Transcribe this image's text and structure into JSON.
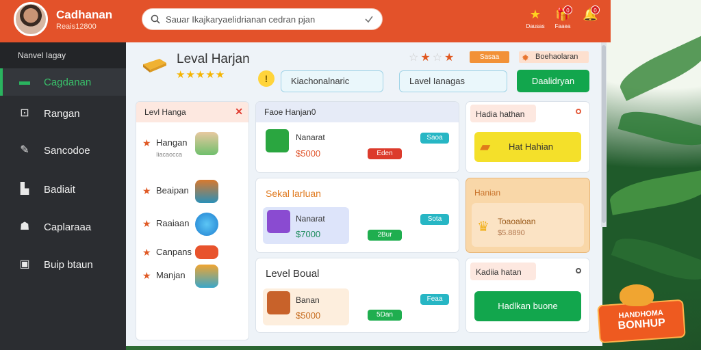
{
  "header": {
    "user_name": "Cadhanan",
    "user_sub": "Reais12800",
    "search_placeholder": "Sauar Ikajkaryaelidrianan cedran pjan",
    "icons": [
      {
        "name": "star-icon",
        "label": "Dausas",
        "glyph": "★",
        "color": "#ffd21f",
        "badge": ""
      },
      {
        "name": "gift-icon",
        "label": "Faaea",
        "glyph": "🎁",
        "color": "#ffffff",
        "badge": "0"
      },
      {
        "name": "bell-icon",
        "label": "",
        "glyph": "🔔",
        "color": "#ffffff",
        "badge": "0"
      }
    ]
  },
  "sidebar": {
    "heading": "Nanvel Iagay",
    "items": [
      {
        "label": "Cagdanan",
        "icon": "chat-icon",
        "glyph": "▬",
        "active": true
      },
      {
        "label": "Rangan",
        "icon": "grid-icon",
        "glyph": "⊡",
        "active": false
      },
      {
        "label": "Sancodoe",
        "icon": "tag-icon",
        "glyph": "✎",
        "active": false
      },
      {
        "label": "Badiait",
        "icon": "boot-icon",
        "glyph": "▙",
        "active": false
      },
      {
        "label": "Caplaraaa",
        "icon": "hat-icon",
        "glyph": "☗",
        "active": false
      },
      {
        "label": "Buip btaun",
        "icon": "box-icon",
        "glyph": "▣",
        "active": false
      }
    ]
  },
  "level": {
    "title": "Leval Harjan",
    "stars": "★★★★★",
    "rating_stars": "☆★☆★",
    "chip_orange": "Sasaa",
    "chip_peach": "Boehaolaran",
    "field1": "Kiachonalnaric",
    "field2": "Lavel Ianagas",
    "button": "Daalidryan"
  },
  "list": {
    "heading": "Levl Hanga",
    "items": [
      {
        "label": "Hangan",
        "sub": "Iiacaocca",
        "thumb": "#7fc8e6"
      },
      {
        "label": "Beaipan",
        "sub": "",
        "thumb": "#e0822f"
      },
      {
        "label": "Raaiaan",
        "sub": "",
        "thumb": "#2e9fe0"
      },
      {
        "label": "Canpans",
        "sub": "",
        "thumb": "#e8532c"
      },
      {
        "label": "Manjan",
        "sub": "",
        "thumb": "#f0a531"
      }
    ]
  },
  "cards": {
    "c1": {
      "head": "Faoe Hanjan0",
      "title": "Nanarat",
      "price": "$5000",
      "pill_teal": "Saoa",
      "pill_red": "Eden"
    },
    "c2": {
      "head": "Sekal larluan",
      "title": "Nanarat",
      "price": "$7000",
      "pill_teal": "Sota",
      "pill_grn": "2Bur"
    },
    "c3": {
      "head": "Level Boual",
      "title": "Banan",
      "price": "$5000",
      "pill_teal": "Feaa",
      "pill_grn": "5Dan"
    },
    "r1": {
      "head": "Hadia hathan",
      "button": "Hat Hahian"
    },
    "r2": {
      "head": "Hanian",
      "title": "Toaoaloan",
      "sub": "$5.8890"
    },
    "r3": {
      "head": "Kadiia hatan",
      "button": "Hadlkan buone"
    }
  },
  "promo": {
    "line1": "HANDHOMA",
    "line2": "BONHUP"
  }
}
